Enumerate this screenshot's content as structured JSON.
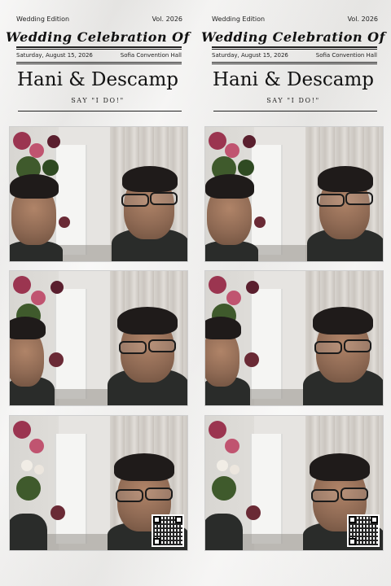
{
  "strips": [
    {
      "edition": "Wedding Edition",
      "volume": "Vol. 2026",
      "title": "Wedding Celebration Of",
      "date": "Saturday, August 15, 2026",
      "venue": "Sofia Convention Hall",
      "couple": "Hani & Descamp",
      "tagline": "SAY \"I DO!\""
    },
    {
      "edition": "Wedding Edition",
      "volume": "Vol. 2026",
      "title": "Wedding Celebration Of",
      "date": "Saturday, August 15, 2026",
      "venue": "Sofia Convention Hall",
      "couple": "Hani & Descamp",
      "tagline": "SAY \"I DO!\""
    }
  ],
  "colors": {
    "paper": "#f0efed",
    "ink": "#111111"
  },
  "icons": {
    "qr": "qr-code"
  }
}
